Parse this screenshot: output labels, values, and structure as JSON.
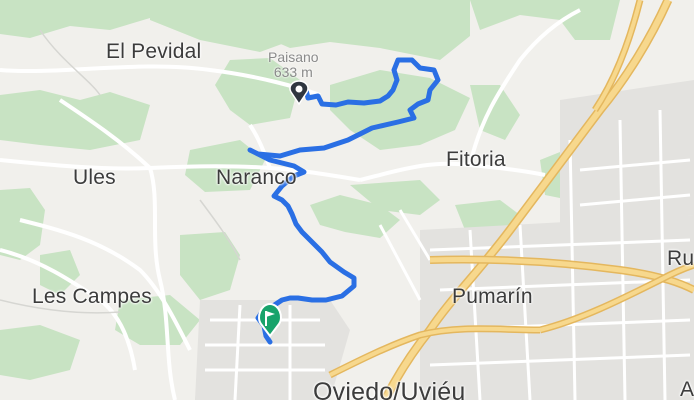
{
  "map": {
    "places": {
      "el_pevidal": "El Pevidal",
      "paisano": "Paisano",
      "paisano_elev": "633 m",
      "ules": "Ules",
      "naranco": "Naranco",
      "fitoria": "Fitoria",
      "les_campes": "Les Campes",
      "pumarin": "Pumarín",
      "oviedo": "Oviedo/Uviéu",
      "edge_ru": "Ru",
      "edge_a": "A"
    },
    "route_color": "#2a6fe4",
    "markers": {
      "start": {
        "icon": "location-pin-icon",
        "color": "#2f3640"
      },
      "end": {
        "icon": "flag-icon",
        "color": "#18a36b"
      }
    }
  }
}
